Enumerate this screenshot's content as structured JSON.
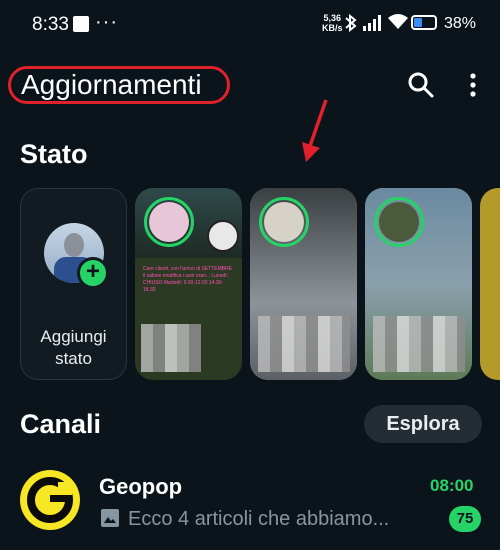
{
  "status_bar": {
    "time": "8:33",
    "net_speed_value": "5,36",
    "net_speed_unit": "KB/s",
    "battery_percent": "38%",
    "battery_level": 0.38
  },
  "header": {
    "title": "Aggiornamenti",
    "highlight_color": "#e0202a"
  },
  "status_section": {
    "title": "Stato",
    "add_status_label": "Aggiungi stato",
    "cards": [
      {
        "caption": ""
      },
      {
        "caption": ""
      },
      {
        "caption": ""
      }
    ],
    "card1_text": "Care clienti, con l'arrivo di SETTEMBRE il salone modifica i suoi orari... Lunedì: CHIUSO Martedì: 9.00-12.00 14.30-18.30"
  },
  "channels_section": {
    "title": "Canali",
    "explore_label": "Esplora",
    "channels": [
      {
        "name": "Geopop",
        "time": "08:00",
        "preview": "Ecco 4 articoli che abbiamo...",
        "unread": "75"
      }
    ]
  },
  "colors": {
    "background": "#0b141a",
    "accent": "#25d366",
    "text_muted": "#8696a0"
  },
  "icons": [
    "search-icon",
    "more-vert-icon",
    "bluetooth-icon",
    "signal-icon",
    "wifi-icon",
    "battery-icon",
    "add-icon",
    "image-icon",
    "arrow-icon"
  ]
}
